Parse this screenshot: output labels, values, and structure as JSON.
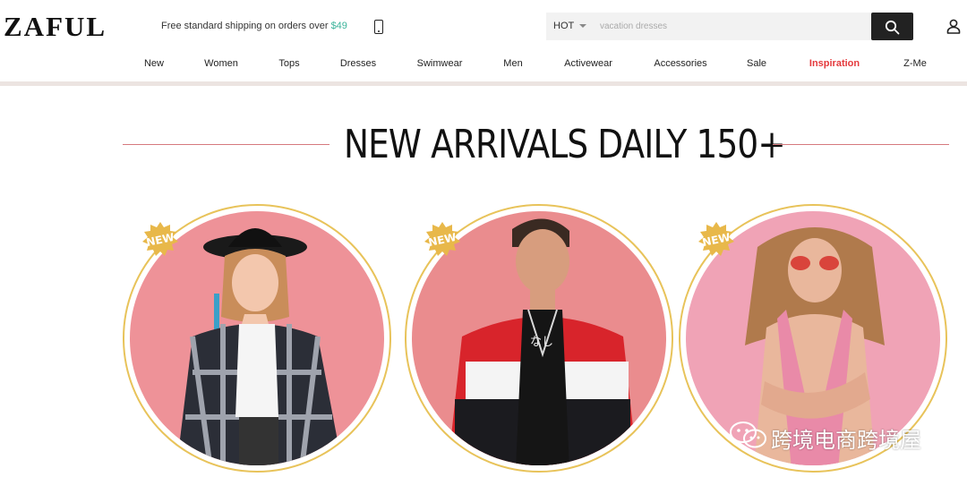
{
  "header": {
    "logo": "ZAFUL",
    "shipping_text": "Free standard shipping on orders over ",
    "shipping_amount": "$49"
  },
  "search": {
    "category": "HOT",
    "placeholder": "vacation dresses"
  },
  "nav": {
    "items": [
      "New",
      "Women",
      "Tops",
      "Dresses",
      "Swimwear",
      "Men",
      "Activewear",
      "Accessories",
      "Sale",
      "Inspiration",
      "Z-Me"
    ],
    "highlighted": "Inspiration"
  },
  "hero": {
    "title": "NEW ARRIVALS DAILY 150+"
  },
  "tiles": [
    {
      "badge": "NEW",
      "subject": "woman in black hat and plaid shirt"
    },
    {
      "badge": "NEW",
      "subject": "man in red white and black track jacket"
    },
    {
      "badge": "NEW",
      "subject": "woman in pink floral swimsuit"
    }
  ],
  "watermark": {
    "text": "跨境电商跨境屋"
  },
  "colors": {
    "accent_red": "#e4393c",
    "shipping_teal": "#3bb39a",
    "badge_gold": "#e8b84a",
    "circle_pink": "#ef8f95"
  }
}
